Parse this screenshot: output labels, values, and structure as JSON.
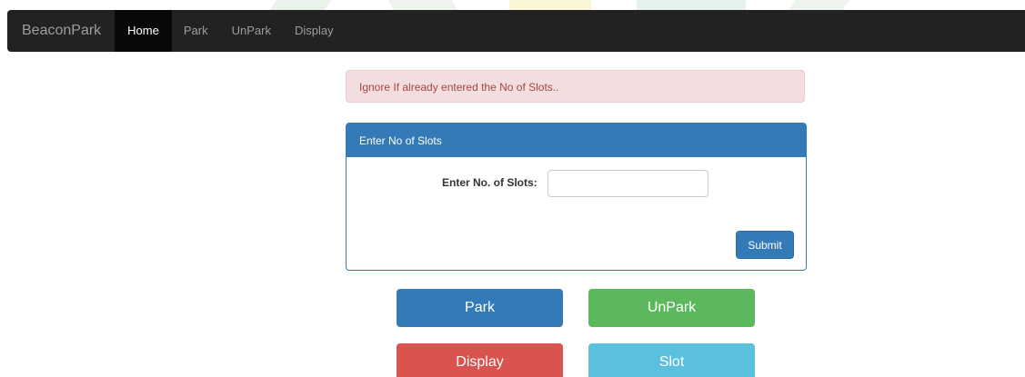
{
  "navbar": {
    "brand": "BeaconPark",
    "items": [
      {
        "label": "Home",
        "active": true
      },
      {
        "label": "Park",
        "active": false
      },
      {
        "label": "UnPark",
        "active": false
      },
      {
        "label": "Display",
        "active": false
      }
    ]
  },
  "alert": {
    "text": "Ignore If already entered the No of Slots.."
  },
  "panel": {
    "heading": "Enter No of Slots",
    "field_label": "Enter No. of Slots:",
    "field_value": "",
    "field_placeholder": "",
    "submit_label": "Submit"
  },
  "actions": {
    "park_label": "Park",
    "unpark_label": "UnPark",
    "display_label": "Display",
    "slot_label": "Slot"
  },
  "colors": {
    "navbar_bg": "#222222",
    "primary": "#337ab7",
    "success": "#5cb85c",
    "danger": "#d9534f",
    "info": "#5bc0de",
    "alert_bg": "#f2dede",
    "alert_text": "#a94442"
  }
}
